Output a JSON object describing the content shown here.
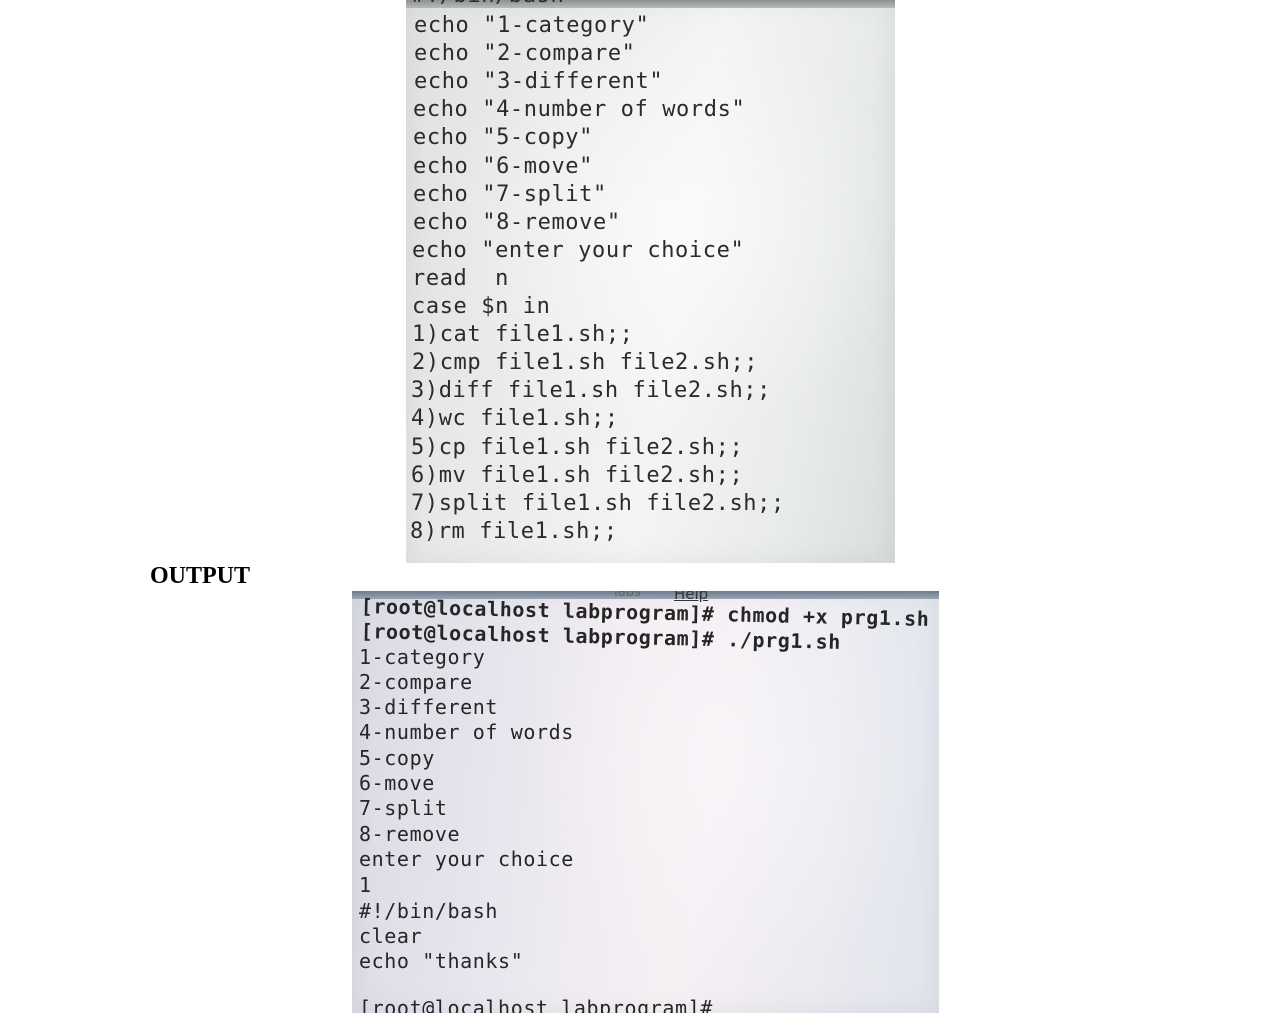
{
  "code_screenshot": {
    "shebang_partial": "#!/bin/bash",
    "lines": [
      "echo \"1-category\"",
      "echo \"2-compare\"",
      "echo \"3-different\"",
      "echo \"4-number of words\"",
      "echo \"5-copy\"",
      "echo \"6-move\"",
      "echo \"7-split\"",
      "echo \"8-remove\"",
      "echo \"enter your choice\"",
      "read  n",
      "case $n in",
      "1)cat file1.sh;;",
      "2)cmp file1.sh file2.sh;;",
      "3)diff file1.sh file2.sh;;",
      "4)wc file1.sh;;",
      "5)cp file1.sh file2.sh;;",
      "6)mv file1.sh file2.sh;;",
      "7)split file1.sh file2.sh;;",
      "8)rm file1.sh;;"
    ]
  },
  "output_heading": "OUTPUT",
  "terminal_screenshot": {
    "menu_partial": "Tabs",
    "menu_help": "Help",
    "lines": [
      "[root@localhost labprogram]# chmod +x prg1.sh",
      "[root@localhost labprogram]# ./prg1.sh",
      "1-category",
      "2-compare",
      "3-different",
      "4-number of words",
      "5-copy",
      "6-move",
      "7-split",
      "8-remove",
      "enter your choice",
      "1",
      "#!/bin/bash",
      "clear",
      "echo \"thanks\"",
      "",
      "[root@localhost labprogram]#"
    ]
  }
}
